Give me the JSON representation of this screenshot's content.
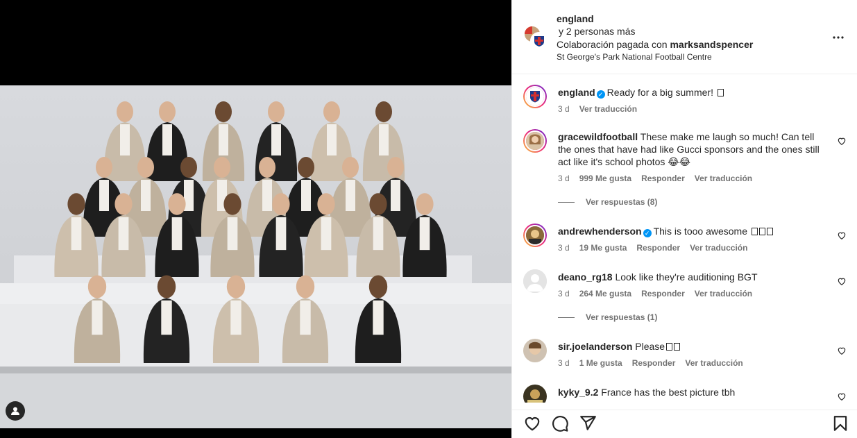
{
  "post": {
    "author": "england",
    "collaborators_line": "y 2 personas más",
    "paid_prefix": "Colaboración pagada con",
    "paid_partner": "marksandspencer",
    "location": "St George's Park National Football Centre"
  },
  "caption": {
    "username": "england",
    "text": "Ready for a big summer! ",
    "time": "3 d",
    "translate": "Ver traducción"
  },
  "comments": [
    {
      "username": "gracewildfootball",
      "text": "These make me laugh so much! Can tell the ones that have had like Gucci sponsors and the ones still act like it's school photos 😂😂",
      "time": "3 d",
      "likes": "999 Me gusta",
      "reply": "Responder",
      "translate": "Ver traducción",
      "replies": "Ver respuestas (8)"
    },
    {
      "username": "andrewhenderson",
      "text": "This is tooo awesome ",
      "time": "3 d",
      "likes": "19 Me gusta",
      "reply": "Responder",
      "translate": "Ver traducción"
    },
    {
      "username": "deano_rg18",
      "text": "Look like they're auditioning BGT",
      "time": "3 d",
      "likes": "264 Me gusta",
      "reply": "Responder",
      "translate": "Ver traducción",
      "replies": "Ver respuestas (1)"
    },
    {
      "username": "sir.joelanderson",
      "text": "Please",
      "time": "3 d",
      "likes": "1 Me gusta",
      "reply": "Responder",
      "translate": "Ver traducción"
    },
    {
      "username": "kyky_9.2",
      "text": "France has the best picture tbh"
    }
  ],
  "icons": [
    "user-tag-icon",
    "more-options-icon",
    "verified-icon",
    "heart-icon",
    "comment-icon",
    "share-icon",
    "bookmark-icon"
  ],
  "colors": {
    "verified": "#0095f6",
    "meta_text": "#737373",
    "text": "#262626"
  }
}
